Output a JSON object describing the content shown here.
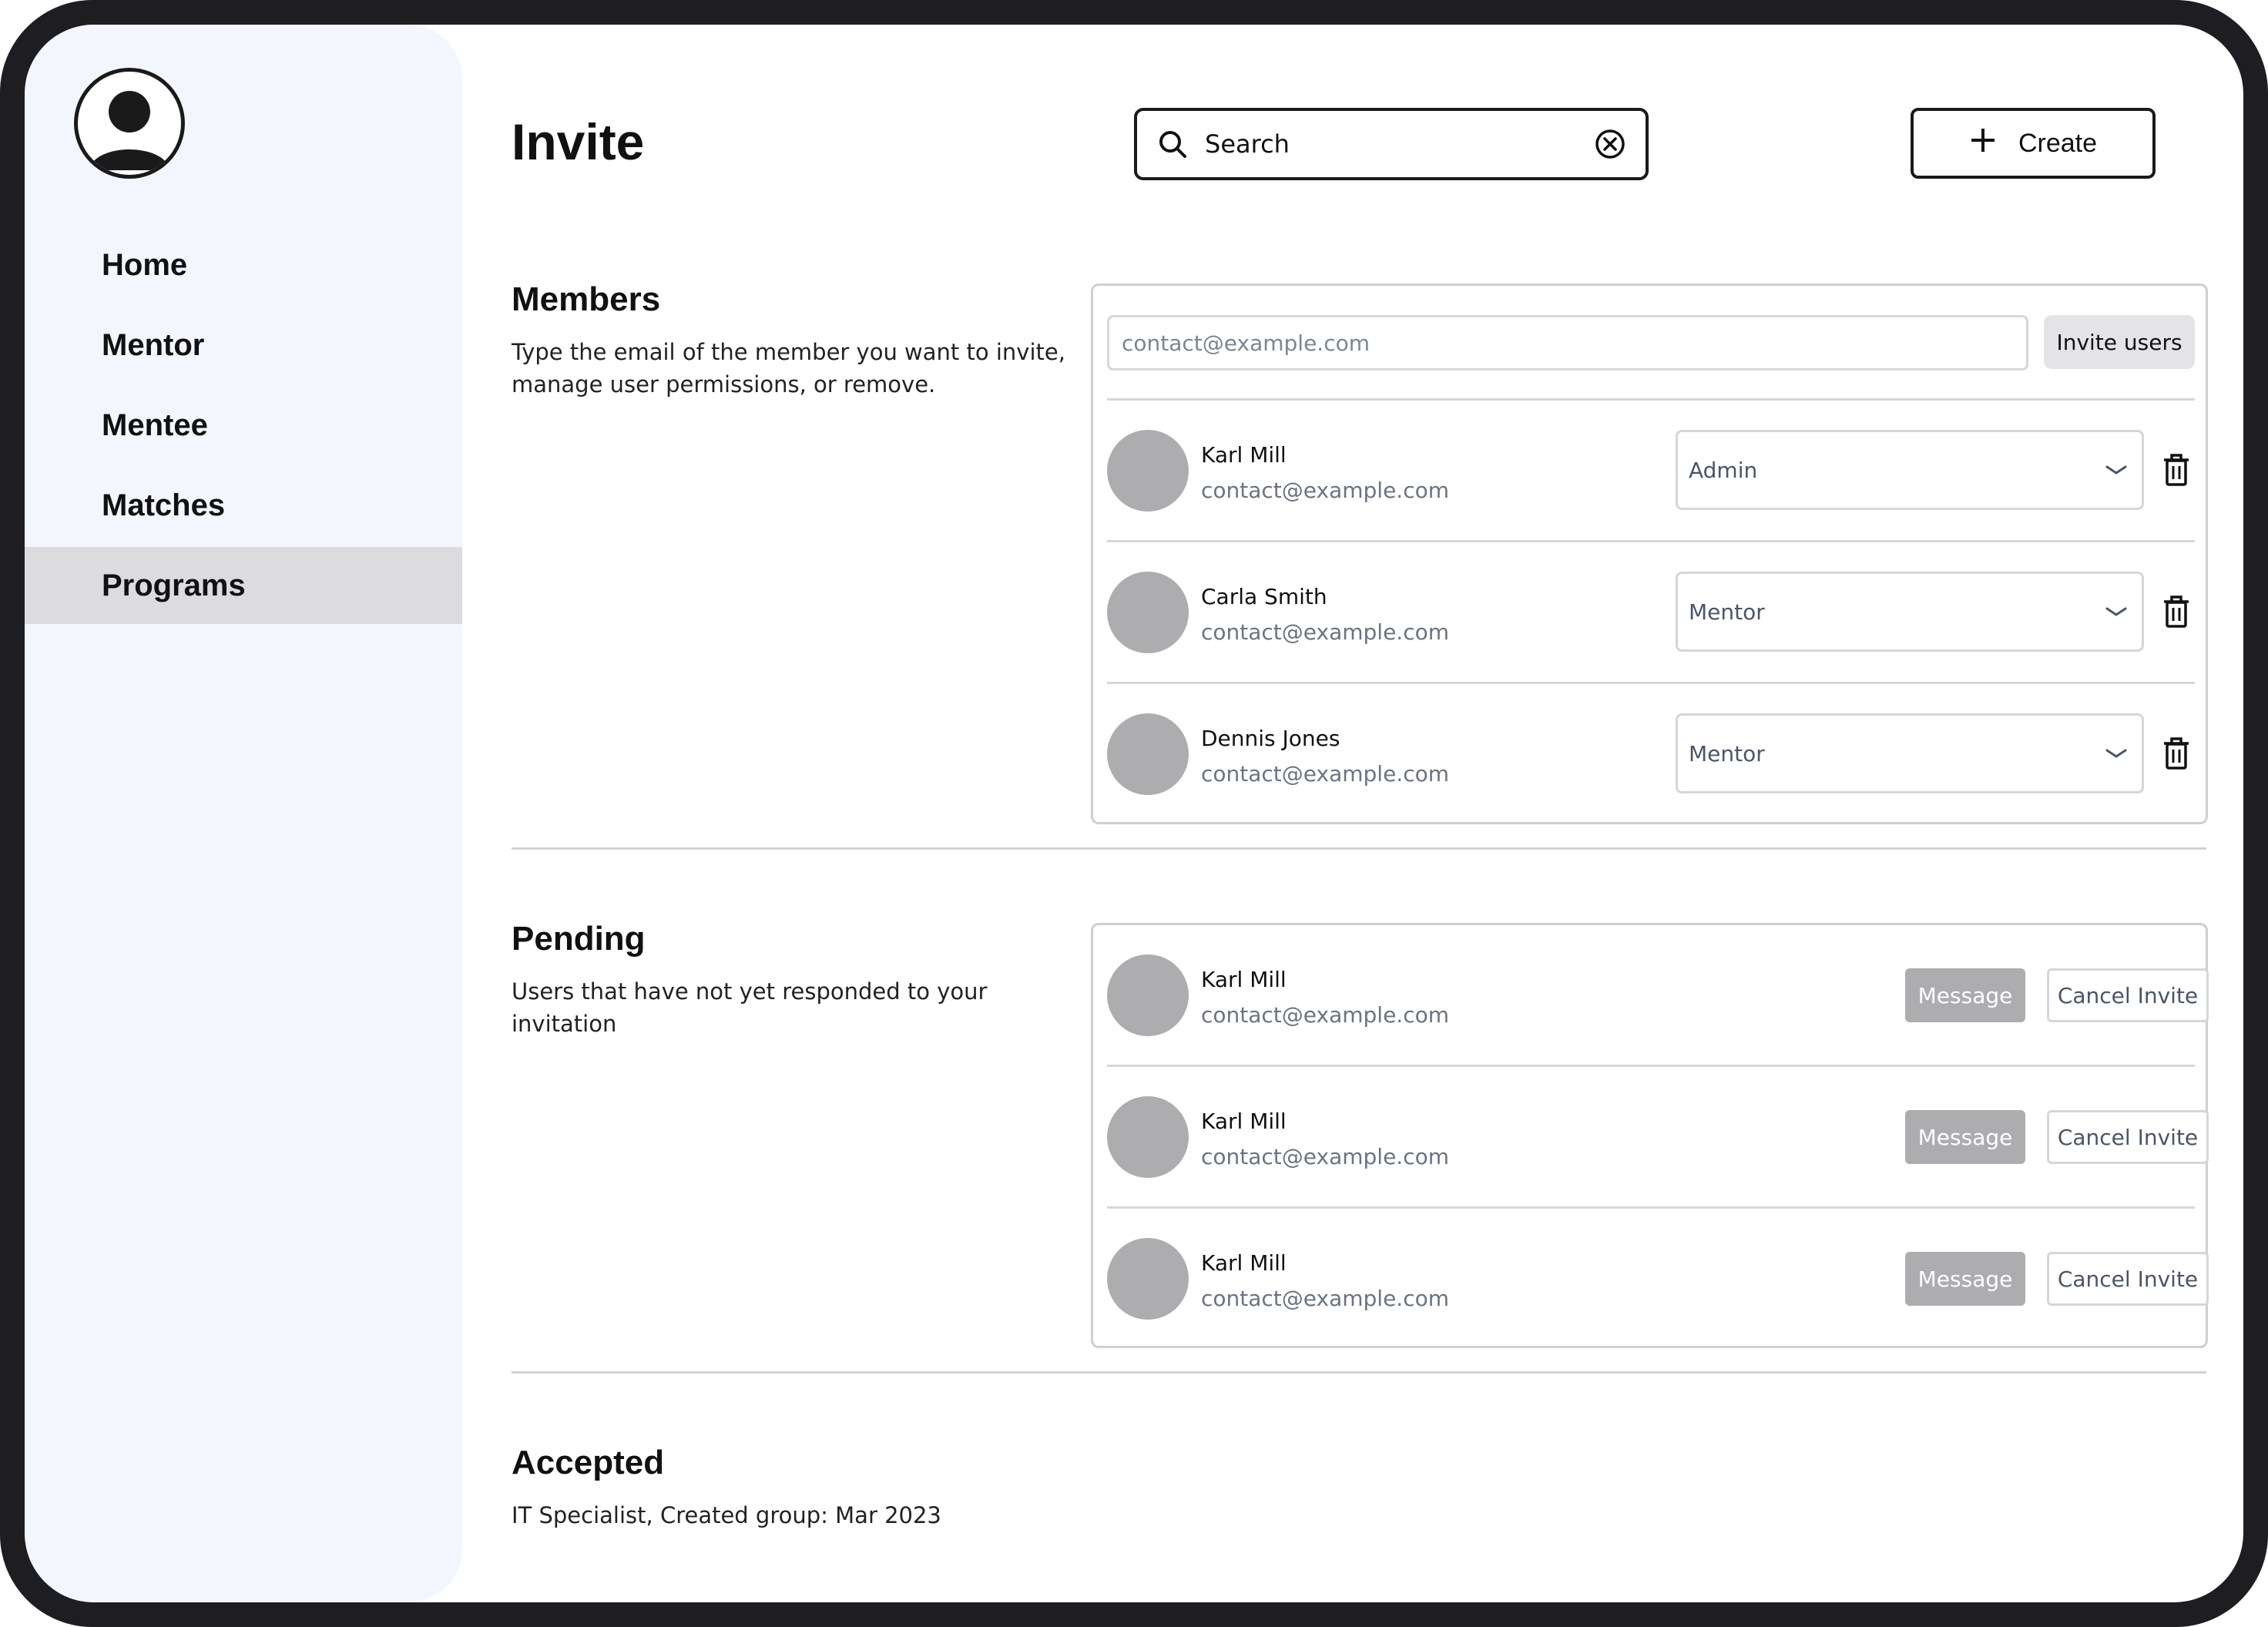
{
  "sidebar": {
    "items": [
      {
        "label": "Home"
      },
      {
        "label": "Mentor"
      },
      {
        "label": "Mentee"
      },
      {
        "label": "Matches"
      },
      {
        "label": "Programs",
        "active": true
      }
    ]
  },
  "header": {
    "title": "Invite",
    "search_placeholder": "Search",
    "create_label": "Create"
  },
  "members": {
    "title": "Members",
    "description": "Type the email of the member you want to invite, manage user permissions, or remove.",
    "invite_placeholder": "contact@example.com",
    "invite_button": "Invite users",
    "people": [
      {
        "name": "Karl Mill",
        "email": "contact@example.com",
        "role": "Admin"
      },
      {
        "name": "Carla Smith",
        "email": "contact@example.com",
        "role": "Mentor"
      },
      {
        "name": "Dennis Jones",
        "email": "contact@example.com",
        "role": "Mentor"
      }
    ]
  },
  "pending": {
    "title": "Pending",
    "description": "Users that have not yet responded to your invitation",
    "message_label": "Message",
    "cancel_label": "Cancel Invite",
    "people": [
      {
        "name": "Karl Mill",
        "email": "contact@example.com"
      },
      {
        "name": "Karl Mill",
        "email": "contact@example.com"
      },
      {
        "name": "Karl Mill",
        "email": "contact@example.com"
      }
    ]
  },
  "accepted": {
    "title": "Accepted",
    "description": "IT Specialist, Created group: Mar 2023"
  },
  "colors": {
    "frame": "#1e1d21",
    "sidebar_bg": "#f3f6fd",
    "active_nav": "#dcdbde",
    "avatar_grey": "#adadb0",
    "muted_text": "#6b7383"
  }
}
